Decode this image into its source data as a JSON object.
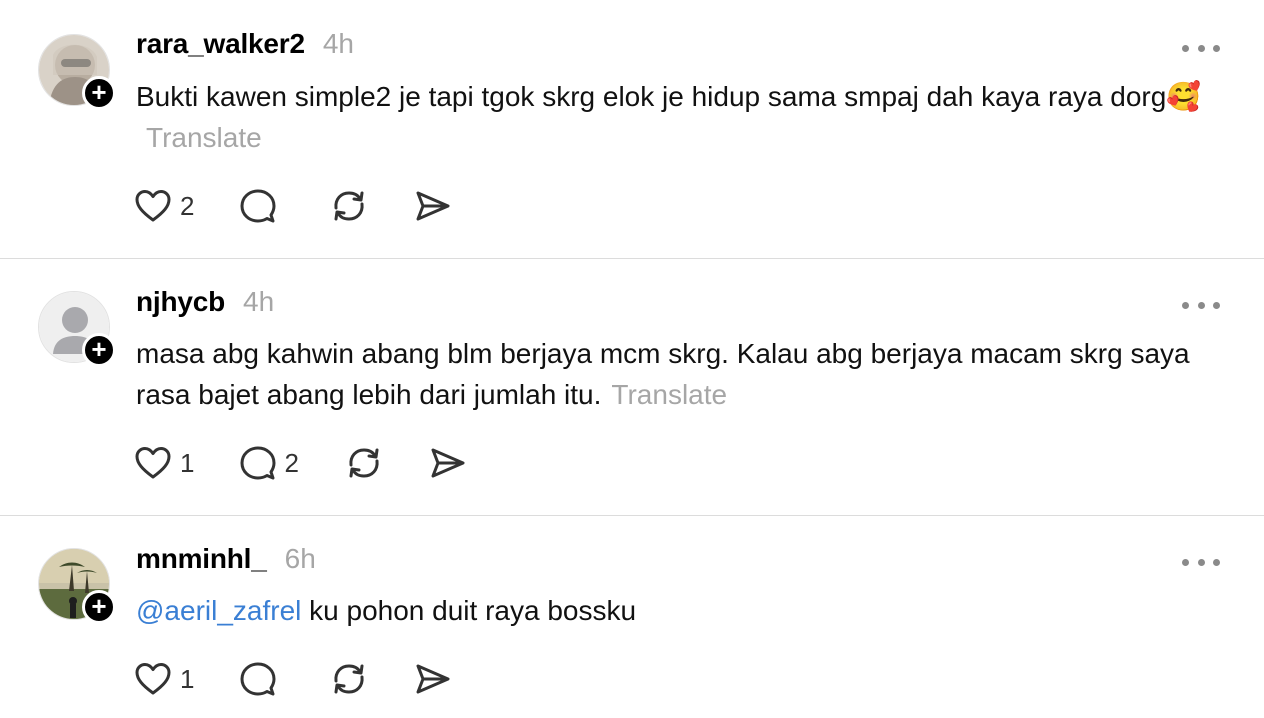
{
  "posts": [
    {
      "username": "rara_walker2",
      "time": "4h",
      "text": "Bukti kawen simple2 je tapi tgok skrg elok je hidup sama smpaj dah kaya raya dorg🥰",
      "translate": "Translate",
      "likes": "2",
      "replies": "",
      "avatar_icon": "photo-avatar-woman-with-sunglasses"
    },
    {
      "username": "njhycb",
      "time": "4h",
      "text": "masa abg kahwin abang blm berjaya mcm skrg. Kalau abg berjaya macam skrg saya rasa bajet abang lebih dari jumlah itu.",
      "translate": "Translate",
      "likes": "1",
      "replies": "2",
      "avatar_icon": "default-person-avatar"
    },
    {
      "username": "mnminhl_",
      "time": "6h",
      "mention": "@aeril_zafrel",
      "text": "ku pohon duit raya bossku",
      "likes": "1",
      "replies": "",
      "avatar_icon": "photo-avatar-palm-trees-sunset"
    }
  ],
  "icons": {
    "like": "heart-icon",
    "reply": "comment-bubble-icon",
    "repost": "repost-icon",
    "share": "send-icon",
    "more": "more-dots-icon",
    "follow": "plus-icon"
  },
  "colors": {
    "mention": "#3a7fd4",
    "secondary_text": "#a6a6a6",
    "divider": "#dcdcdc"
  }
}
